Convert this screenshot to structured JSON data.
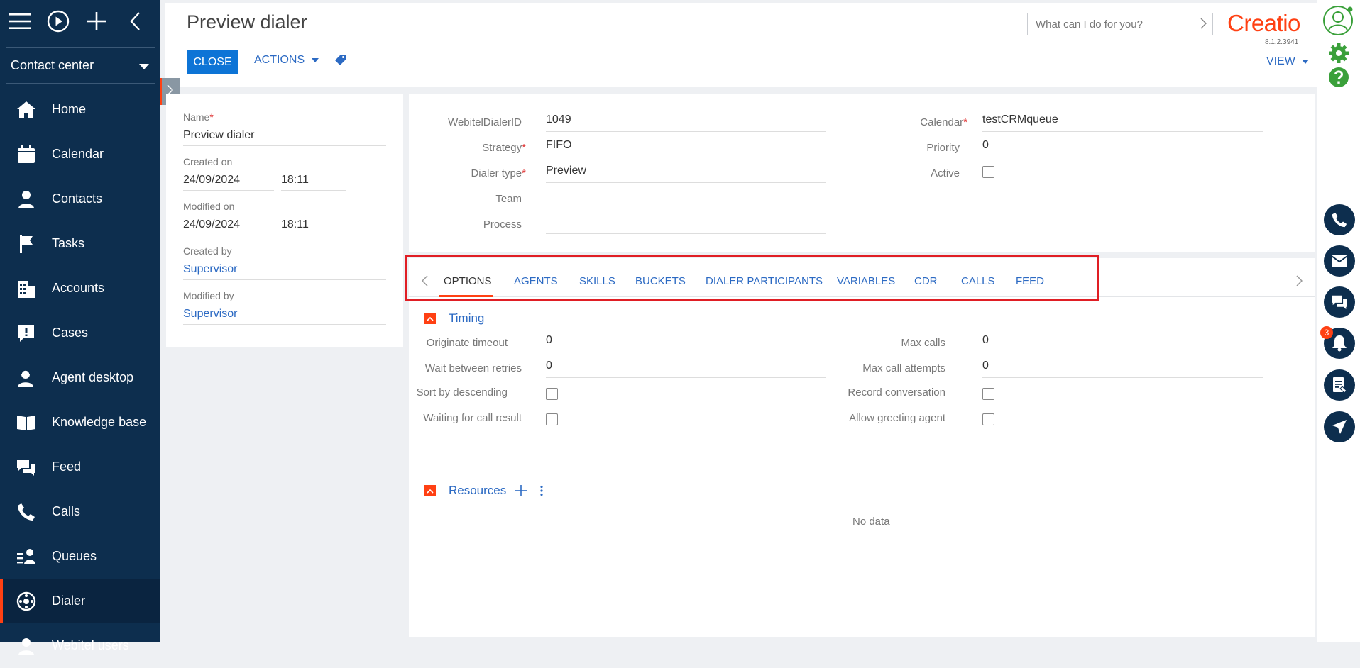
{
  "sidebar": {
    "workplace": "Contact center",
    "items": [
      {
        "label": "Home",
        "icon": "home-icon"
      },
      {
        "label": "Calendar",
        "icon": "calendar-icon"
      },
      {
        "label": "Contacts",
        "icon": "contacts-icon"
      },
      {
        "label": "Tasks",
        "icon": "flag-icon"
      },
      {
        "label": "Accounts",
        "icon": "accounts-icon"
      },
      {
        "label": "Cases",
        "icon": "cases-icon"
      },
      {
        "label": "Agent desktop",
        "icon": "agent-icon"
      },
      {
        "label": "Knowledge base",
        "icon": "book-icon"
      },
      {
        "label": "Feed",
        "icon": "feed-icon"
      },
      {
        "label": "Calls",
        "icon": "phone-icon"
      },
      {
        "label": "Queues",
        "icon": "queues-icon"
      },
      {
        "label": "Dialer",
        "icon": "dialer-icon"
      },
      {
        "label": "Webitel users",
        "icon": "users-icon"
      }
    ],
    "active": "Dialer"
  },
  "header": {
    "title": "Preview dialer",
    "close_label": "CLOSE",
    "actions_label": "ACTIONS",
    "search_placeholder": "What can I do for you?",
    "logo_text": "Creatio",
    "version": "8.1.2.3941",
    "view_label": "VIEW"
  },
  "left_card": {
    "name_label": "Name",
    "name_value": "Preview dialer",
    "created_on_label": "Created on",
    "created_date": "24/09/2024",
    "created_time": "18:11",
    "modified_on_label": "Modified on",
    "modified_date": "24/09/2024",
    "modified_time": "18:11",
    "created_by_label": "Created by",
    "created_by_value": "Supervisor",
    "modified_by_label": "Modified by",
    "modified_by_value": "Supervisor"
  },
  "top_card": {
    "webitel_label": "WebitelDialerID",
    "webitel_value": "1049",
    "strategy_label": "Strategy",
    "strategy_value": "FIFO",
    "dialer_type_label": "Dialer type",
    "dialer_type_value": "Preview",
    "team_label": "Team",
    "team_value": "",
    "process_label": "Process",
    "process_value": "",
    "calendar_label": "Calendar",
    "calendar_value": "testCRMqueue",
    "priority_label": "Priority",
    "priority_value": "0",
    "active_label": "Active"
  },
  "tabs": [
    "OPTIONS",
    "AGENTS",
    "SKILLS",
    "BUCKETS",
    "DIALER PARTICIPANTS",
    "VARIABLES",
    "CDR",
    "CALLS",
    "FEED"
  ],
  "timing": {
    "title": "Timing",
    "originate_timeout_label": "Originate timeout",
    "originate_timeout_value": "0",
    "wait_label": "Wait between retries",
    "wait_value": "0",
    "sort_label": "Sort by descending",
    "waiting_label": "Waiting for call result",
    "max_calls_label": "Max calls",
    "max_calls_value": "0",
    "max_attempts_label": "Max call attempts",
    "max_attempts_value": "0",
    "record_label": "Record conversation",
    "greeting_label": "Allow greeting agent"
  },
  "resources": {
    "title": "Resources",
    "empty_text": "No data"
  },
  "notifications_count": "3",
  "colors": {
    "sidebar": "#0d2e4e",
    "accent": "#ff4013",
    "link": "#2c6ac3",
    "primary_button": "#0d74d6",
    "highlight": "#e01e24"
  }
}
